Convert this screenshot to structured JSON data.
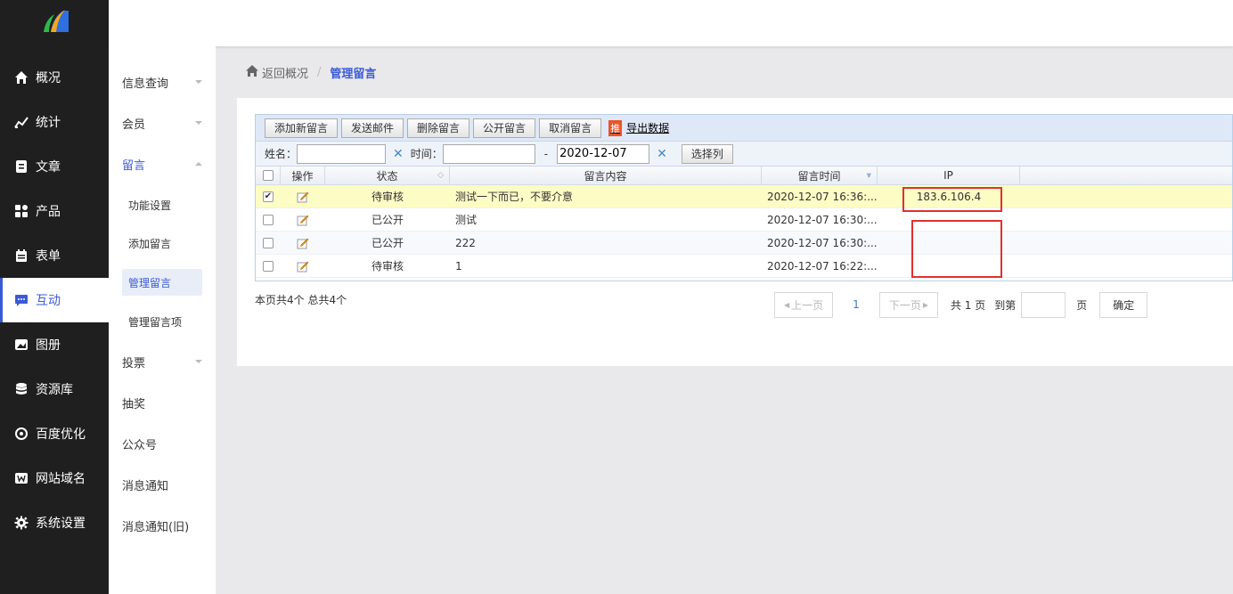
{
  "sidebar": {
    "items": [
      {
        "label": "概况",
        "icon": "home-icon"
      },
      {
        "label": "统计",
        "icon": "chart-icon"
      },
      {
        "label": "文章",
        "icon": "article-icon"
      },
      {
        "label": "产品",
        "icon": "grid-icon"
      },
      {
        "label": "表单",
        "icon": "form-icon"
      },
      {
        "label": "互动",
        "icon": "message-icon"
      },
      {
        "label": "图册",
        "icon": "gallery-icon"
      },
      {
        "label": "资源库",
        "icon": "database-icon"
      },
      {
        "label": "百度优化",
        "icon": "seo-icon"
      },
      {
        "label": "网站域名",
        "icon": "domain-icon"
      },
      {
        "label": "系统设置",
        "icon": "gear-icon"
      }
    ],
    "active": "互动"
  },
  "subnav": {
    "items": [
      "信息查询",
      "会员",
      "留言",
      "投票",
      "抽奖",
      "公众号",
      "消息通知",
      "消息通知(旧)"
    ],
    "sub": [
      "功能设置",
      "添加留言",
      "管理留言",
      "管理留言项"
    ],
    "selected": "管理留言"
  },
  "breadcrumb": {
    "back": "返回概况",
    "sep": "/",
    "current": "管理留言"
  },
  "toolbar": {
    "add": "添加新留言",
    "email": "发送邮件",
    "delete": "删除留言",
    "publish": "公开留言",
    "cancel": "取消留言",
    "tui": "推",
    "export": "导出数据"
  },
  "filter": {
    "name_label": "姓名：",
    "name_value": "",
    "time_label": "时间：",
    "time_from": "",
    "dash": "-",
    "time_to": "2020-12-07",
    "clear": "✕",
    "select_cols": "选择列"
  },
  "table": {
    "headers": [
      "操作",
      "状态",
      "留言内容",
      "留言时间",
      "IP"
    ],
    "rows": [
      {
        "checked": true,
        "status": "待审核",
        "content": "测试一下而已，不要介意",
        "time": "2020-12-07 16:36:...",
        "ip": "183.6.106.4"
      },
      {
        "checked": false,
        "status": "已公开",
        "content": "测试",
        "time": "2020-12-07 16:30:...",
        "ip": ""
      },
      {
        "checked": false,
        "status": "已公开",
        "content": "222",
        "time": "2020-12-07 16:30:...",
        "ip": ""
      },
      {
        "checked": false,
        "status": "待审核",
        "content": "1",
        "time": "2020-12-07 16:22:...",
        "ip": ""
      }
    ]
  },
  "summary": "本页共4个 总共4个",
  "pager": {
    "prev": "上一页",
    "page": "1",
    "next": "下一页",
    "total": "共 1 页",
    "goto": "到第",
    "page_unit": "页",
    "confirm": "确定"
  },
  "colors": {
    "accent": "#3a5bd6",
    "sidebar_bg": "#1f1f1f",
    "highlight_row": "#fcfcc5",
    "annotation": "#e0312e"
  }
}
